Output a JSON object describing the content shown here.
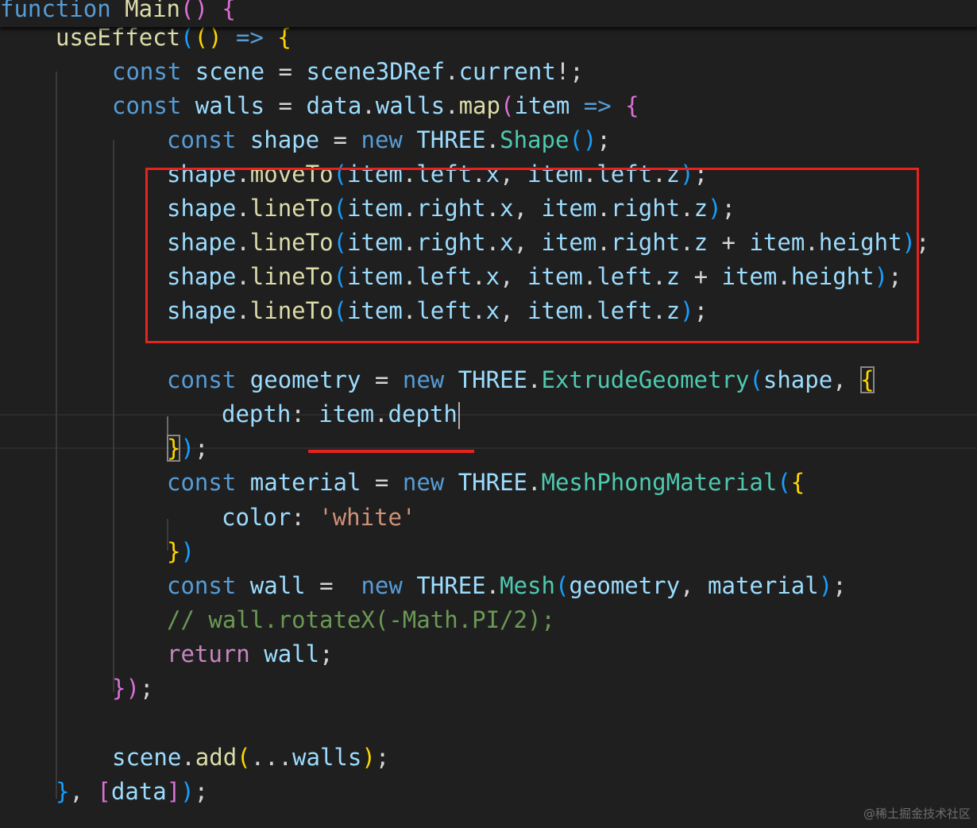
{
  "editor": {
    "theme_colors": {
      "background": "#1f1f1f",
      "keyword": "#569cd6",
      "control": "#c586c0",
      "function": "#dcdcaa",
      "variable": "#9cdcfe",
      "class": "#4ec9b0",
      "string": "#ce9178",
      "comment": "#6a9955",
      "annotation": "#e8221d"
    },
    "sticky_header": {
      "text": "function Main() {",
      "tokens": [
        {
          "t": "function",
          "c": "kw"
        },
        {
          "t": " ",
          "c": "op"
        },
        {
          "t": "Main",
          "c": "fn"
        },
        {
          "t": "()",
          "c": "b2"
        },
        {
          "t": " ",
          "c": "op"
        },
        {
          "t": "{",
          "c": "b2"
        }
      ]
    },
    "lines": [
      {
        "text": "useEffect(() => {",
        "tokens": [
          {
            "t": "useEffect",
            "c": "fn"
          },
          {
            "t": "(",
            "c": "b3"
          },
          {
            "t": "()",
            "c": "b1"
          },
          {
            "t": " ",
            "c": "op"
          },
          {
            "t": "=>",
            "c": "kw"
          },
          {
            "t": " ",
            "c": "op"
          },
          {
            "t": "{",
            "c": "b1"
          }
        ]
      },
      {
        "text": "const scene = scene3DRef.current!;",
        "tokens": [
          {
            "t": "const",
            "c": "kw"
          },
          {
            "t": " ",
            "c": "op"
          },
          {
            "t": "scene",
            "c": "var"
          },
          {
            "t": " = ",
            "c": "op"
          },
          {
            "t": "scene3DRef",
            "c": "var"
          },
          {
            "t": ".",
            "c": "op"
          },
          {
            "t": "current",
            "c": "var"
          },
          {
            "t": "!;",
            "c": "op"
          }
        ]
      },
      {
        "text": "const walls = data.walls.map(item => {",
        "tokens": [
          {
            "t": "const",
            "c": "kw"
          },
          {
            "t": " ",
            "c": "op"
          },
          {
            "t": "walls",
            "c": "var"
          },
          {
            "t": " = ",
            "c": "op"
          },
          {
            "t": "data",
            "c": "var"
          },
          {
            "t": ".",
            "c": "op"
          },
          {
            "t": "walls",
            "c": "var"
          },
          {
            "t": ".",
            "c": "op"
          },
          {
            "t": "map",
            "c": "fn"
          },
          {
            "t": "(",
            "c": "b2"
          },
          {
            "t": "item",
            "c": "var"
          },
          {
            "t": " ",
            "c": "op"
          },
          {
            "t": "=>",
            "c": "kw"
          },
          {
            "t": " ",
            "c": "op"
          },
          {
            "t": "{",
            "c": "b2"
          }
        ]
      },
      {
        "text": "const shape = new THREE.Shape();",
        "tokens": [
          {
            "t": "const",
            "c": "kw"
          },
          {
            "t": " ",
            "c": "op"
          },
          {
            "t": "shape",
            "c": "var"
          },
          {
            "t": " = ",
            "c": "op"
          },
          {
            "t": "new",
            "c": "kw"
          },
          {
            "t": " ",
            "c": "op"
          },
          {
            "t": "THREE",
            "c": "var"
          },
          {
            "t": ".",
            "c": "op"
          },
          {
            "t": "Shape",
            "c": "cls"
          },
          {
            "t": "()",
            "c": "b3"
          },
          {
            "t": ";",
            "c": "op"
          }
        ]
      },
      {
        "text": "shape.moveTo(item.left.x, item.left.z);",
        "tokens": [
          {
            "t": "shape",
            "c": "var"
          },
          {
            "t": ".",
            "c": "op"
          },
          {
            "t": "moveTo",
            "c": "fn"
          },
          {
            "t": "(",
            "c": "b3"
          },
          {
            "t": "item",
            "c": "var"
          },
          {
            "t": ".",
            "c": "op"
          },
          {
            "t": "left",
            "c": "var"
          },
          {
            "t": ".",
            "c": "op"
          },
          {
            "t": "x",
            "c": "var"
          },
          {
            "t": ", ",
            "c": "op"
          },
          {
            "t": "item",
            "c": "var"
          },
          {
            "t": ".",
            "c": "op"
          },
          {
            "t": "left",
            "c": "var"
          },
          {
            "t": ".",
            "c": "op"
          },
          {
            "t": "z",
            "c": "var"
          },
          {
            "t": ")",
            "c": "b3"
          },
          {
            "t": ";",
            "c": "op"
          }
        ]
      },
      {
        "text": "shape.lineTo(item.right.x, item.right.z);",
        "tokens": [
          {
            "t": "shape",
            "c": "var"
          },
          {
            "t": ".",
            "c": "op"
          },
          {
            "t": "lineTo",
            "c": "fn"
          },
          {
            "t": "(",
            "c": "b3"
          },
          {
            "t": "item",
            "c": "var"
          },
          {
            "t": ".",
            "c": "op"
          },
          {
            "t": "right",
            "c": "var"
          },
          {
            "t": ".",
            "c": "op"
          },
          {
            "t": "x",
            "c": "var"
          },
          {
            "t": ", ",
            "c": "op"
          },
          {
            "t": "item",
            "c": "var"
          },
          {
            "t": ".",
            "c": "op"
          },
          {
            "t": "right",
            "c": "var"
          },
          {
            "t": ".",
            "c": "op"
          },
          {
            "t": "z",
            "c": "var"
          },
          {
            "t": ")",
            "c": "b3"
          },
          {
            "t": ";",
            "c": "op"
          }
        ]
      },
      {
        "text": "shape.lineTo(item.right.x, item.right.z + item.height);",
        "tokens": [
          {
            "t": "shape",
            "c": "var"
          },
          {
            "t": ".",
            "c": "op"
          },
          {
            "t": "lineTo",
            "c": "fn"
          },
          {
            "t": "(",
            "c": "b3"
          },
          {
            "t": "item",
            "c": "var"
          },
          {
            "t": ".",
            "c": "op"
          },
          {
            "t": "right",
            "c": "var"
          },
          {
            "t": ".",
            "c": "op"
          },
          {
            "t": "x",
            "c": "var"
          },
          {
            "t": ", ",
            "c": "op"
          },
          {
            "t": "item",
            "c": "var"
          },
          {
            "t": ".",
            "c": "op"
          },
          {
            "t": "right",
            "c": "var"
          },
          {
            "t": ".",
            "c": "op"
          },
          {
            "t": "z",
            "c": "var"
          },
          {
            "t": " + ",
            "c": "op"
          },
          {
            "t": "item",
            "c": "var"
          },
          {
            "t": ".",
            "c": "op"
          },
          {
            "t": "height",
            "c": "var"
          },
          {
            "t": ")",
            "c": "b3"
          },
          {
            "t": ";",
            "c": "op"
          }
        ]
      },
      {
        "text": "shape.lineTo(item.left.x, item.left.z + item.height);",
        "tokens": [
          {
            "t": "shape",
            "c": "var"
          },
          {
            "t": ".",
            "c": "op"
          },
          {
            "t": "lineTo",
            "c": "fn"
          },
          {
            "t": "(",
            "c": "b3"
          },
          {
            "t": "item",
            "c": "var"
          },
          {
            "t": ".",
            "c": "op"
          },
          {
            "t": "left",
            "c": "var"
          },
          {
            "t": ".",
            "c": "op"
          },
          {
            "t": "x",
            "c": "var"
          },
          {
            "t": ", ",
            "c": "op"
          },
          {
            "t": "item",
            "c": "var"
          },
          {
            "t": ".",
            "c": "op"
          },
          {
            "t": "left",
            "c": "var"
          },
          {
            "t": ".",
            "c": "op"
          },
          {
            "t": "z",
            "c": "var"
          },
          {
            "t": " + ",
            "c": "op"
          },
          {
            "t": "item",
            "c": "var"
          },
          {
            "t": ".",
            "c": "op"
          },
          {
            "t": "height",
            "c": "var"
          },
          {
            "t": ")",
            "c": "b3"
          },
          {
            "t": ";",
            "c": "op"
          }
        ]
      },
      {
        "text": "shape.lineTo(item.left.x, item.left.z);",
        "tokens": [
          {
            "t": "shape",
            "c": "var"
          },
          {
            "t": ".",
            "c": "op"
          },
          {
            "t": "lineTo",
            "c": "fn"
          },
          {
            "t": "(",
            "c": "b3"
          },
          {
            "t": "item",
            "c": "var"
          },
          {
            "t": ".",
            "c": "op"
          },
          {
            "t": "left",
            "c": "var"
          },
          {
            "t": ".",
            "c": "op"
          },
          {
            "t": "x",
            "c": "var"
          },
          {
            "t": ", ",
            "c": "op"
          },
          {
            "t": "item",
            "c": "var"
          },
          {
            "t": ".",
            "c": "op"
          },
          {
            "t": "left",
            "c": "var"
          },
          {
            "t": ".",
            "c": "op"
          },
          {
            "t": "z",
            "c": "var"
          },
          {
            "t": ")",
            "c": "b3"
          },
          {
            "t": ";",
            "c": "op"
          }
        ]
      },
      {
        "text": "",
        "tokens": []
      },
      {
        "text": "const geometry = new THREE.ExtrudeGeometry(shape, {",
        "tokens": [
          {
            "t": "const",
            "c": "kw"
          },
          {
            "t": " ",
            "c": "op"
          },
          {
            "t": "geometry",
            "c": "var"
          },
          {
            "t": " = ",
            "c": "op"
          },
          {
            "t": "new",
            "c": "kw"
          },
          {
            "t": " ",
            "c": "op"
          },
          {
            "t": "THREE",
            "c": "var"
          },
          {
            "t": ".",
            "c": "op"
          },
          {
            "t": "ExtrudeGeometry",
            "c": "cls"
          },
          {
            "t": "(",
            "c": "b3"
          },
          {
            "t": "shape",
            "c": "var"
          },
          {
            "t": ", ",
            "c": "op"
          },
          {
            "t": "{",
            "c": "b1 b1box"
          }
        ]
      },
      {
        "text": "depth: item.depth",
        "tokens": [
          {
            "t": "depth",
            "c": "var"
          },
          {
            "t": ": ",
            "c": "op"
          },
          {
            "t": "item",
            "c": "var"
          },
          {
            "t": ".",
            "c": "op"
          },
          {
            "t": "depth",
            "c": "var"
          }
        ]
      },
      {
        "text": "});",
        "tokens": [
          {
            "t": "}",
            "c": "b1 b1box"
          },
          {
            "t": ")",
            "c": "b3"
          },
          {
            "t": ";",
            "c": "op"
          }
        ]
      },
      {
        "text": "const material = new THREE.MeshPhongMaterial({",
        "tokens": [
          {
            "t": "const",
            "c": "kw"
          },
          {
            "t": " ",
            "c": "op"
          },
          {
            "t": "material",
            "c": "var"
          },
          {
            "t": " = ",
            "c": "op"
          },
          {
            "t": "new",
            "c": "kw"
          },
          {
            "t": " ",
            "c": "op"
          },
          {
            "t": "THREE",
            "c": "var"
          },
          {
            "t": ".",
            "c": "op"
          },
          {
            "t": "MeshPhongMaterial",
            "c": "cls"
          },
          {
            "t": "(",
            "c": "b3"
          },
          {
            "t": "{",
            "c": "b1"
          }
        ]
      },
      {
        "text": "color: 'white'",
        "tokens": [
          {
            "t": "color",
            "c": "var"
          },
          {
            "t": ": ",
            "c": "op"
          },
          {
            "t": "'white'",
            "c": "str"
          }
        ]
      },
      {
        "text": "})",
        "tokens": [
          {
            "t": "}",
            "c": "b1"
          },
          {
            "t": ")",
            "c": "b3"
          }
        ]
      },
      {
        "text": "const wall =  new THREE.Mesh(geometry, material);",
        "tokens": [
          {
            "t": "const",
            "c": "kw"
          },
          {
            "t": " ",
            "c": "op"
          },
          {
            "t": "wall",
            "c": "var"
          },
          {
            "t": " =  ",
            "c": "op"
          },
          {
            "t": "new",
            "c": "kw"
          },
          {
            "t": " ",
            "c": "op"
          },
          {
            "t": "THREE",
            "c": "var"
          },
          {
            "t": ".",
            "c": "op"
          },
          {
            "t": "Mesh",
            "c": "cls"
          },
          {
            "t": "(",
            "c": "b3"
          },
          {
            "t": "geometry",
            "c": "var"
          },
          {
            "t": ", ",
            "c": "op"
          },
          {
            "t": "material",
            "c": "var"
          },
          {
            "t": ")",
            "c": "b3"
          },
          {
            "t": ";",
            "c": "op"
          }
        ]
      },
      {
        "text": "// wall.rotateX(-Math.PI/2);",
        "tokens": [
          {
            "t": "// wall.rotateX(-Math.PI/2);",
            "c": "cmt"
          }
        ]
      },
      {
        "text": "return wall;",
        "tokens": [
          {
            "t": "return",
            "c": "ctl"
          },
          {
            "t": " ",
            "c": "op"
          },
          {
            "t": "wall",
            "c": "var"
          },
          {
            "t": ";",
            "c": "op"
          }
        ]
      },
      {
        "text": "});",
        "tokens": [
          {
            "t": "}",
            "c": "b2"
          },
          {
            "t": ")",
            "c": "b2"
          },
          {
            "t": ";",
            "c": "op"
          }
        ]
      },
      {
        "text": "",
        "tokens": []
      },
      {
        "text": "scene.add(...walls);",
        "tokens": [
          {
            "t": "scene",
            "c": "var"
          },
          {
            "t": ".",
            "c": "op"
          },
          {
            "t": "add",
            "c": "fn"
          },
          {
            "t": "(",
            "c": "b1"
          },
          {
            "t": "...",
            "c": "op"
          },
          {
            "t": "walls",
            "c": "var"
          },
          {
            "t": ")",
            "c": "b1"
          },
          {
            "t": ";",
            "c": "op"
          }
        ]
      },
      {
        "text": "}, [data]);",
        "tokens": [
          {
            "t": "}",
            "c": "b3"
          },
          {
            "t": ", ",
            "c": "op"
          },
          {
            "t": "[",
            "c": "b2"
          },
          {
            "t": "data",
            "c": "var"
          },
          {
            "t": "]",
            "c": "b2"
          },
          {
            "t": ")",
            "c": "b3"
          },
          {
            "t": ";",
            "c": "op"
          }
        ]
      }
    ]
  },
  "watermark": "@稀土掘金技术社区"
}
